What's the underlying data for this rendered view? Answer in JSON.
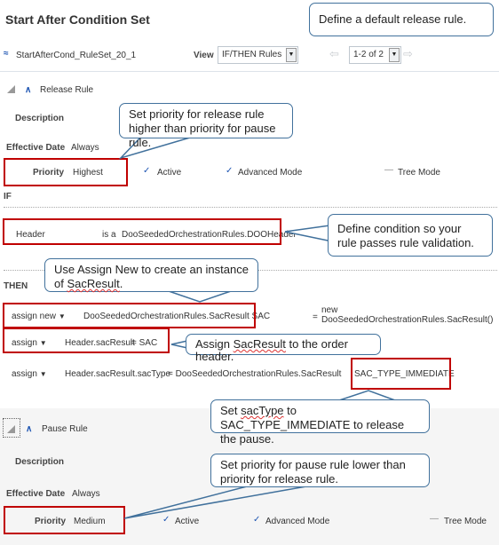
{
  "page": {
    "title": "Start After Condition Set"
  },
  "ruleset": {
    "name": "StartAfterCond_RuleSet_20_1",
    "view_label": "View",
    "view_value": "IF/THEN Rules",
    "pagination_value": "1-2 of 2"
  },
  "release_rule": {
    "title": "Release Rule",
    "description_label": "Description",
    "effective_date_label": "Effective Date",
    "effective_date_value": "Always",
    "priority_label": "Priority",
    "priority_value": "Highest",
    "active_label": "Active",
    "advanced_mode_label": "Advanced Mode",
    "tree_mode_label": "Tree Mode",
    "if_label": "IF",
    "condition": {
      "variable": "Header",
      "operator": "is a",
      "type": "DooSeededOrchestrationRules.DOOHeader"
    },
    "then_label": "THEN",
    "actions": [
      {
        "action": "assign new",
        "target": "DooSeededOrchestrationRules.SacResult  SAC",
        "value_prefix": "=",
        "value_line1": "new",
        "value_line2": "DooSeededOrchestrationRules.SacResult()"
      },
      {
        "action": "assign",
        "target": "Header.sacResult",
        "value": "= SAC"
      },
      {
        "action": "assign",
        "target": "Header.sacResult.sacType",
        "value": "= DooSeededOrchestrationRules.SacResult",
        "value_highlight": "SAC_TYPE_IMMEDIATE"
      }
    ]
  },
  "pause_rule": {
    "title": "Pause Rule",
    "description_label": "Description",
    "effective_date_label": "Effective Date",
    "effective_date_value": "Always",
    "priority_label": "Priority",
    "priority_value": "Medium",
    "active_label": "Active",
    "advanced_mode_label": "Advanced Mode",
    "tree_mode_label": "Tree Mode"
  },
  "callouts": {
    "default_release": "Define a default release rule.",
    "priority_higher": "Set priority for release rule higher than priority for pause rule.",
    "condition": "Define condition so your rule passes rule validation.",
    "assign_new_pre": "Use Assign New to create an instance of ",
    "assign_new_term": "SacResult",
    "assign_new_post": ".",
    "assign_header_pre": "Assign ",
    "assign_header_term": "SacResult",
    "assign_header_post": " to the order header.",
    "sactype_pre": "Set ",
    "sactype_term": "sacType",
    "sactype_post": " to SAC_TYPE_IMMEDIATE to release the pause.",
    "priority_lower": "Set priority for pause rule lower than priority for release rule."
  },
  "colors": {
    "callout_border": "#41719c",
    "highlight_box": "#c00000",
    "chevron": "#1f56b3"
  }
}
